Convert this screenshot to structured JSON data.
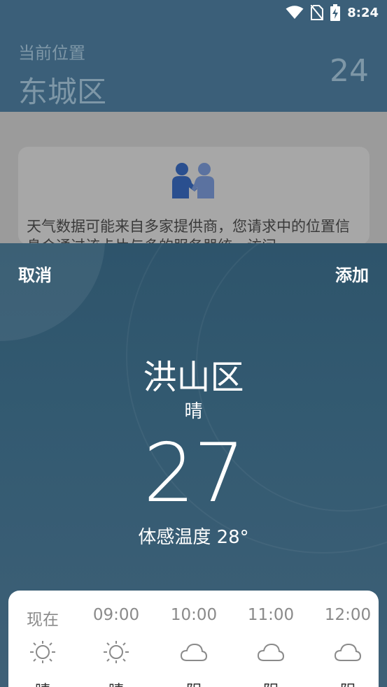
{
  "status_bar": {
    "time": "8:24"
  },
  "header": {
    "current_location_label": "当前位置",
    "location_name": "东城区",
    "temperature": "24"
  },
  "notice": {
    "text": "天气数据可能来自多家提供商，您请求中的位置信息会通过该卡片与多的服务器统一访问"
  },
  "sheet": {
    "cancel_label": "取消",
    "add_label": "添加",
    "city": "洪山区",
    "condition": "晴",
    "temperature": "27",
    "feels_like": "体感温度 28°"
  },
  "forecast": [
    {
      "time": "现在",
      "icon": "sun-icon",
      "condition": "晴"
    },
    {
      "time": "09:00",
      "icon": "sun-icon",
      "condition": "晴"
    },
    {
      "time": "10:00",
      "icon": "cloud-icon",
      "condition": "阴"
    },
    {
      "time": "11:00",
      "icon": "cloud-icon",
      "condition": "阴"
    },
    {
      "time": "12:00",
      "icon": "cloud-icon",
      "condition": "阴"
    }
  ]
}
